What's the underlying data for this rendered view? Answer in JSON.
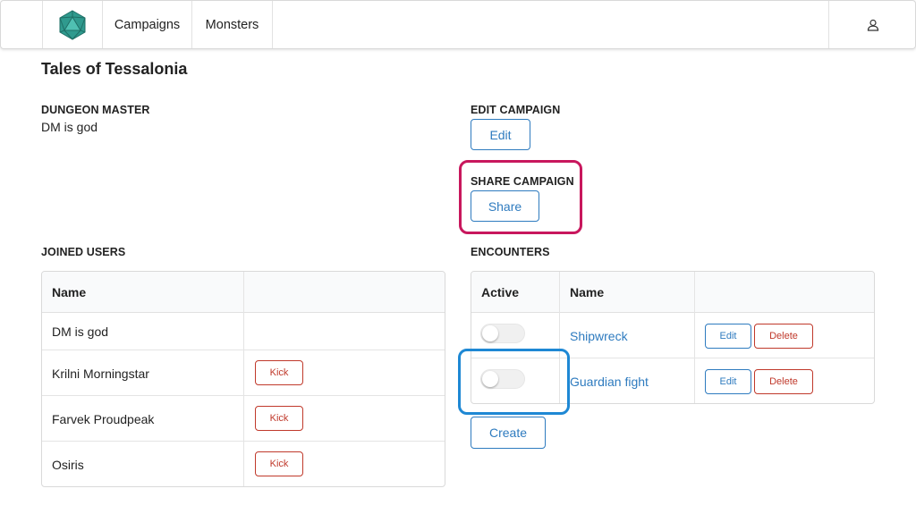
{
  "nav": {
    "logo_icon": "d20-dice-icon",
    "items": [
      {
        "label": "Campaigns"
      },
      {
        "label": "Monsters"
      }
    ],
    "user_icon": "user-icon"
  },
  "campaign": {
    "title": "Tales of Tessalonia",
    "dungeon_master_label": "DUNGEON MASTER",
    "dungeon_master_name": "DM is god",
    "edit_label": "EDIT CAMPAIGN",
    "edit_button": "Edit",
    "share_label": "SHARE CAMPAIGN",
    "share_button": "Share"
  },
  "joined_users": {
    "label": "JOINED USERS",
    "columns": [
      "Name",
      ""
    ],
    "rows": [
      {
        "name": "DM is god",
        "action": ""
      },
      {
        "name": "Krilni Morningstar",
        "action": "Kick"
      },
      {
        "name": "Farvek Proudpeak",
        "action": "Kick"
      },
      {
        "name": "Osiris",
        "action": "Kick"
      }
    ]
  },
  "encounters": {
    "label": "ENCOUNTERS",
    "columns": [
      "Active",
      "Name",
      ""
    ],
    "rows": [
      {
        "active": false,
        "name": "Shipwreck",
        "edit": "Edit",
        "delete": "Delete"
      },
      {
        "active": false,
        "name": "Guardian fight",
        "edit": "Edit",
        "delete": "Delete"
      }
    ],
    "create_button": "Create"
  },
  "colors": {
    "primary": "#2e7bbf",
    "danger": "#c0392b",
    "highlight_pink": "#c8175d",
    "highlight_blue": "#1e88d4"
  }
}
